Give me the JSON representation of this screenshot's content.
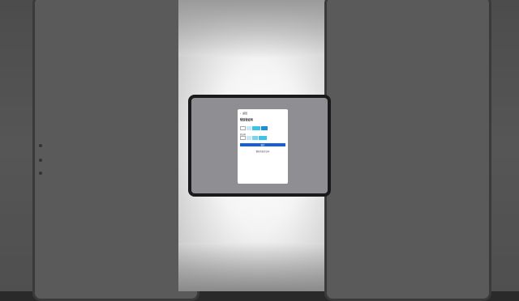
{
  "dialog": {
    "back_label": "返回",
    "title": "短信验证码",
    "field_label": "验证码",
    "confirm_label": "确定",
    "link_text": "重新获取验证码"
  },
  "colors": {
    "primary_button": "#1560d6",
    "accent_cyan": "#3cc3e8",
    "accent_blue": "#1b8fd6",
    "screen_bg": "#8f8e93"
  },
  "icons": {
    "back": "chevron-left-icon"
  }
}
